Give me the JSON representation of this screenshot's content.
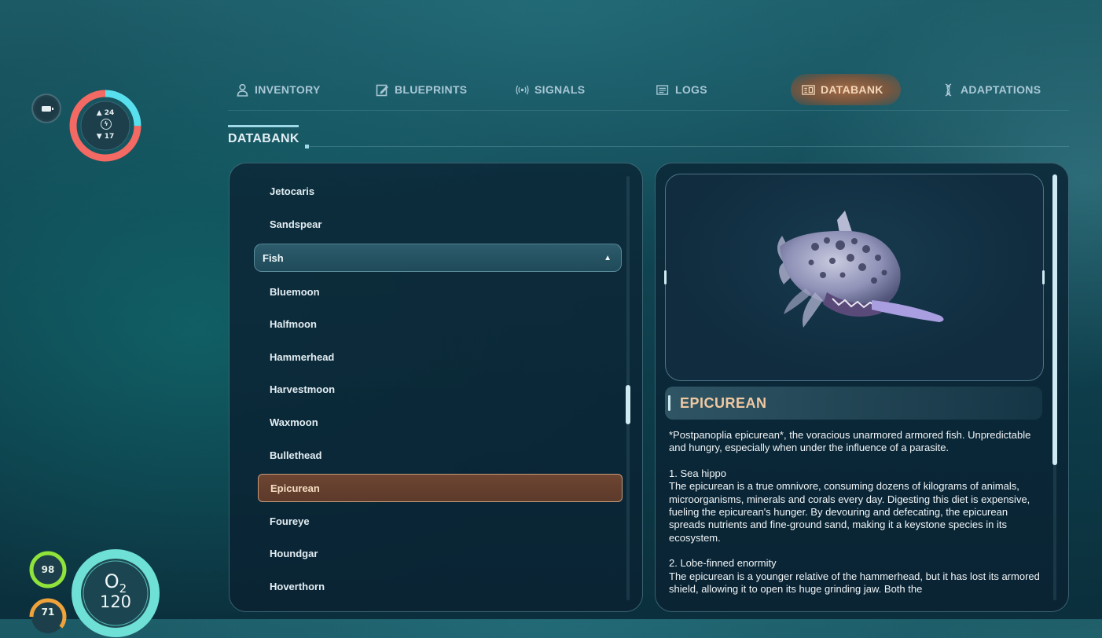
{
  "hud": {
    "power_up": "24",
    "power_down": "17",
    "health": "98",
    "food": "71",
    "oxygen_label": "O",
    "oxygen_sub": "2",
    "oxygen_value": "120",
    "power_fraction_cyan": 0.25,
    "health_fraction": 1.0,
    "colors": {
      "power_red": "#f26a63",
      "power_cyan": "#58e0ef",
      "health_green": "#8fe33a",
      "food_orange": "#f0a33a",
      "oxygen_teal": "#6fe0d5"
    }
  },
  "tabs": [
    {
      "label": "INVENTORY",
      "icon": "person-icon"
    },
    {
      "label": "BLUEPRINTS",
      "icon": "blueprint-icon"
    },
    {
      "label": "SIGNALS",
      "icon": "signal-icon"
    },
    {
      "label": "LOGS",
      "icon": "logs-icon"
    },
    {
      "label": "DATABANK",
      "icon": "databank-icon",
      "active": true
    },
    {
      "label": "ADAPTATIONS",
      "icon": "dna-icon"
    }
  ],
  "section": {
    "title": "DATABANK"
  },
  "list": {
    "items_above": [
      "Jetocaris",
      "Sandspear"
    ],
    "category": "Fish",
    "items": [
      "Bluemoon",
      "Halfmoon",
      "Hammerhead",
      "Harvestmoon",
      "Waxmoon",
      "Bullethead",
      "Epicurean",
      "Foureye",
      "Houndgar",
      "Hoverthorn"
    ],
    "selected": "Epicurean"
  },
  "entry": {
    "title": "EPICUREAN",
    "intro": "*Postpanoplia epicurean*, the voracious unarmored armored fish. Unpredictable and hungry, especially when under the influence of a parasite.",
    "section1_title": "1. Sea hippo",
    "section1_body": "The epicurean is a true omnivore, consuming dozens of kilograms of animals, microorganisms, minerals and corals every day. Digesting this diet is expensive, fueling the epicurean's hunger. By devouring and defecating, the epicurean spreads nutrients and fine-ground sand, making it a keystone species in its ecosystem.",
    "section2_title": "2. Lobe-finned enormity",
    "section2_body": "The epicurean is a younger relative of the hammerhead, but it has lost its armored shield, allowing it to open its huge grinding jaw. Both the"
  },
  "accent_color": "#f0c9a2"
}
